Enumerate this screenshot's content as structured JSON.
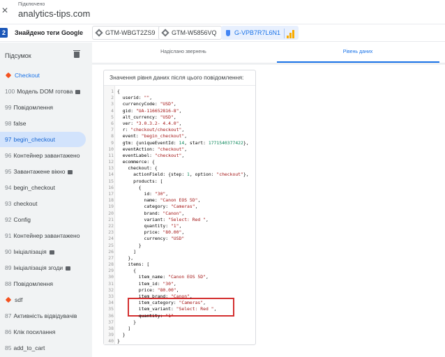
{
  "header": {
    "close_icon": "close-icon",
    "status": "Підключено",
    "site": "analytics-tips.com"
  },
  "tagbar": {
    "count": "2",
    "label": "Знайдено теги Google",
    "chips": [
      {
        "id": "GTM-WBGT2ZS9",
        "icon": "gtm-diamond-icon"
      },
      {
        "id": "GTM-W5856VQ",
        "icon": "gtm-diamond-icon"
      },
      {
        "id": "G-VPB7R7L6N1",
        "icon": "shield-icon",
        "selected": true
      }
    ]
  },
  "sidebar": {
    "title": "Підсумок",
    "items": [
      {
        "num": "",
        "label": "Checkout",
        "marker": true,
        "blue": true
      },
      {
        "num": "100",
        "label": "Модель DOM готова",
        "badge": true
      },
      {
        "num": "99",
        "label": "Повідомлення"
      },
      {
        "num": "98",
        "label": "false"
      },
      {
        "num": "97",
        "label": "begin_checkout",
        "active": true
      },
      {
        "num": "96",
        "label": "Контейнер завантажено"
      },
      {
        "num": "95",
        "label": "Завантажене вікно",
        "badge": true
      },
      {
        "num": "94",
        "label": "begin_checkout"
      },
      {
        "num": "93",
        "label": "checkout"
      },
      {
        "num": "92",
        "label": "Config"
      },
      {
        "num": "91",
        "label": "Контейнер завантажено"
      },
      {
        "num": "90",
        "label": "Ініціалізація",
        "badge": true
      },
      {
        "num": "89",
        "label": "Ініціалізація згоди",
        "badge": true
      },
      {
        "num": "88",
        "label": "Повідомлення"
      },
      {
        "num": "",
        "label": "sdf",
        "marker": true
      },
      {
        "num": "87",
        "label": "Активність відвідувачів"
      },
      {
        "num": "86",
        "label": "Клік посилання"
      },
      {
        "num": "85",
        "label": "add_to_cart"
      }
    ]
  },
  "tabs": [
    {
      "label": "Надіслано звернень"
    },
    {
      "label": "Рівень даних",
      "active": true
    }
  ],
  "card": {
    "title": "Значення рівня даних після цього повідомлення:",
    "lines": [
      "{",
      "  userid: \"\",",
      "  currencyCode: \"USD\",",
      "  gid: \"UA-116652816-8\",",
      "  alt_currency: \"USD\",",
      "  ver: \"3.0.3.2- 4.4.0\",",
      "  r: \"checkout/checkout\",",
      "  event: \"begin_checkout\",",
      "  gtm: {uniqueEventId: 14, start: 1771540377422},",
      "  eventAction: \"checkout\",",
      "  eventLabel: \"checkout\",",
      "  ecommerce: {",
      "    checkout: {",
      "      actionField: {step: 1, option: \"checkout\"},",
      "      products: [",
      "        {",
      "          id: \"30\",",
      "          name: \"Canon EOS 5D\",",
      "          category: \"Cameras\",",
      "          brand: \"Canon\",",
      "          variant: \"Select: Red \",",
      "          quantity: \"1\",",
      "          price: \"80.00\",",
      "          currency: \"USD\"",
      "        }",
      "      ]",
      "    },",
      "    items: [",
      "      {",
      "        item_name: \"Canon EOS 5D\",",
      "        item_id: \"30\",",
      "        price: \"80.00\",",
      "        item_brand: \"Canon\",",
      "        item_category: \"Cameras\",",
      "        item_variant: \"Select: Red \",",
      "        quantity: \"1\"",
      "      }",
      "    ]",
      "  }",
      "}"
    ],
    "highlight_lines": [
      34,
      36
    ],
    "highlight_color": "#d32f2f"
  }
}
